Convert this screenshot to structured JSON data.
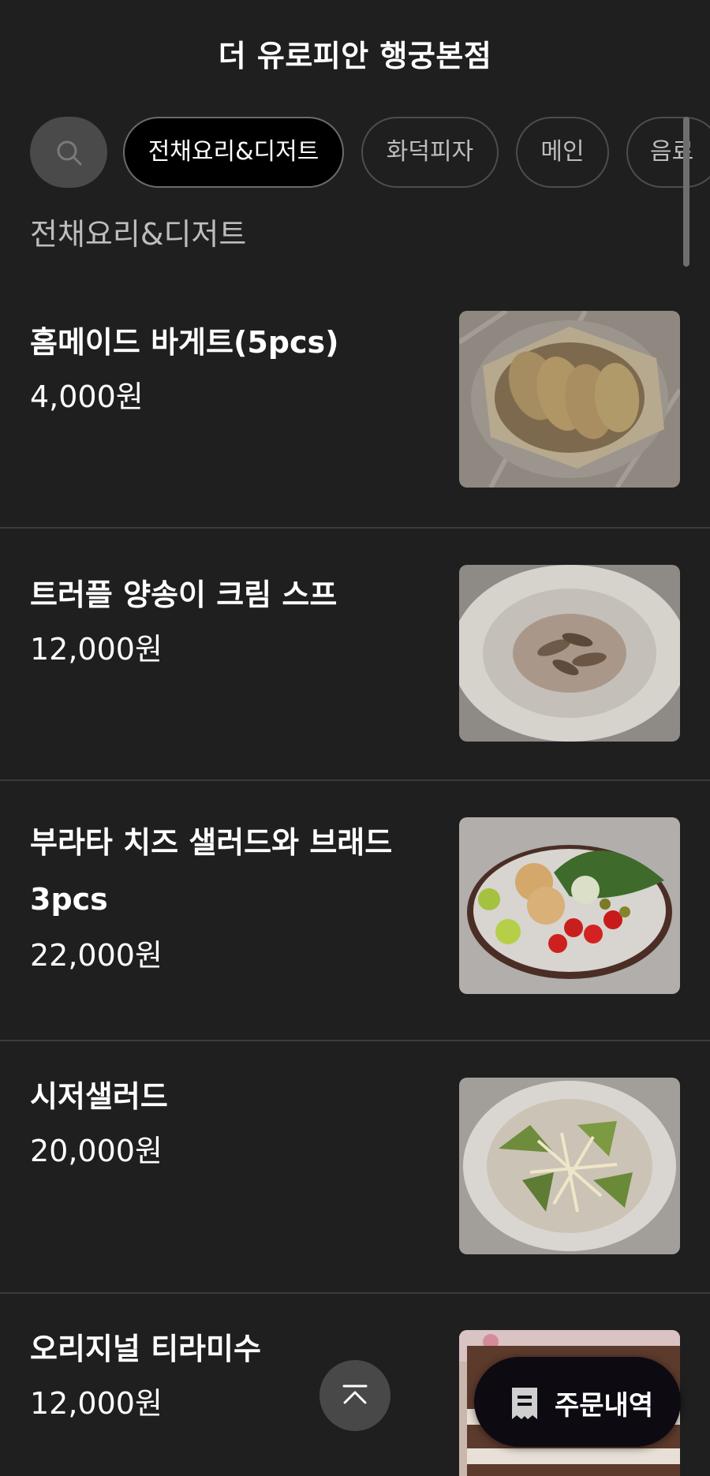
{
  "header": {
    "title": "더 유로피안 행궁본점"
  },
  "categories": {
    "tabs": [
      {
        "label": "전채요리&디저트",
        "active": true
      },
      {
        "label": "화덕피자",
        "active": false
      },
      {
        "label": "메인",
        "active": false
      },
      {
        "label": "음료",
        "active": false
      }
    ]
  },
  "section": {
    "title": "전채요리&디저트"
  },
  "menu": {
    "items": [
      {
        "name": "홈메이드 바게트(5pcs)",
        "price": "4,000원",
        "photo": "bread-photo"
      },
      {
        "name": "트러플 양송이 크림 스프",
        "price": "12,000원",
        "photo": "soup-photo"
      },
      {
        "name": "부라타 치즈 샐러드와 브래드 3pcs",
        "price": "22,000원",
        "photo": "burrata-salad-photo"
      },
      {
        "name": "시저샐러드",
        "price": "20,000원",
        "photo": "caesar-salad-photo"
      },
      {
        "name": "오리지널 티라미수",
        "price": "12,000원",
        "photo": "tiramisu-photo"
      }
    ]
  },
  "floating": {
    "order_label": "주문내역",
    "order_icon": "receipt-icon",
    "scroll_top_icon": "chevron-up-icon"
  }
}
